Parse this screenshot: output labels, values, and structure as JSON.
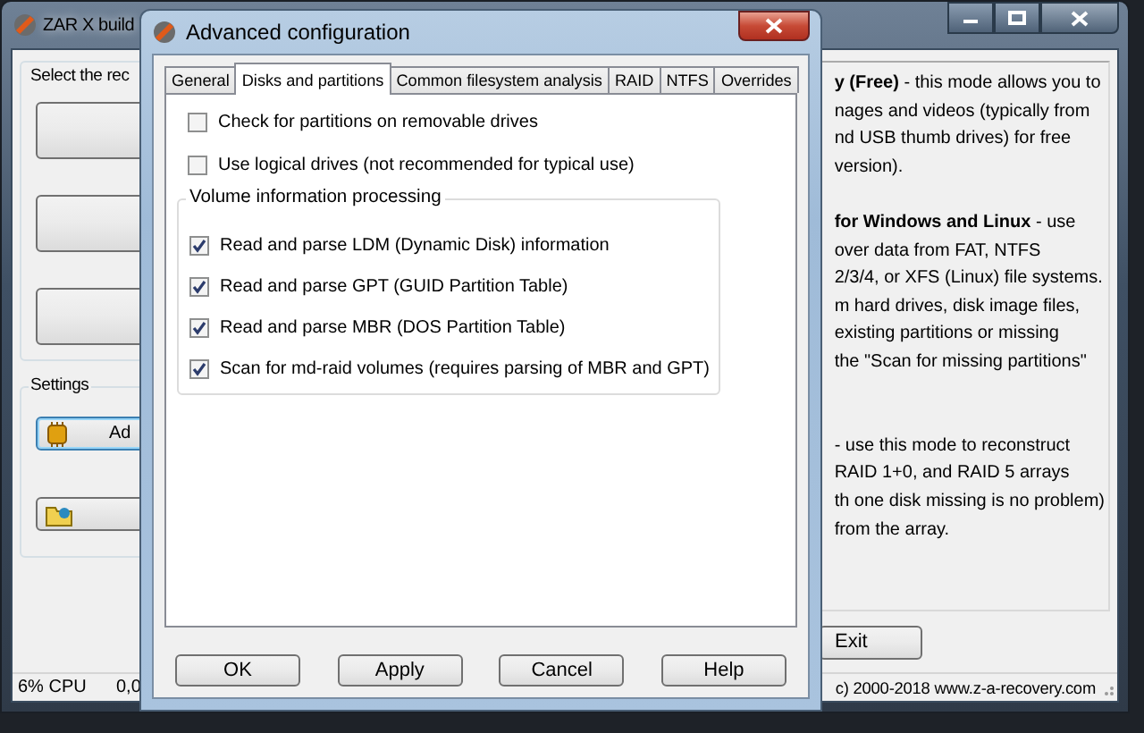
{
  "main_window": {
    "title": "ZAR X build",
    "select_group": {
      "title": "Select the rec"
    },
    "settings_group": {
      "title": "Settings",
      "buttons": [
        {
          "kind": "chip",
          "label": "Ad"
        },
        {
          "kind": "folder"
        }
      ]
    },
    "description": [
      {
        "text": "**y (Free)** - this mode allows you to"
      },
      {
        "text": "nages and videos (typically from"
      },
      {
        "text": "nd USB thumb drives) for free"
      },
      {
        "text": " version)."
      },
      {
        "kind": "gap"
      },
      {
        "text": "**for Windows and Linux** - use"
      },
      {
        "text": "over data from FAT, NTFS"
      },
      {
        "text": "2/3/4, or XFS (Linux) file systems."
      },
      {
        "text": "m hard drives, disk image files,"
      },
      {
        "text": "existing partitions or missing"
      },
      {
        "text": "the \"Scan for missing partitions\""
      },
      {
        "kind": "gap"
      },
      {
        "kind": "gap"
      },
      {
        "text": "- use this mode to reconstruct"
      },
      {
        "text": "RAID 1+0, and RAID 5 arrays"
      },
      {
        "text": "th one disk missing is no problem)"
      },
      {
        "text": "from the array."
      }
    ],
    "exit_button": "Exit",
    "status_bar": [
      "6% CPU",
      "0,0",
      "c) 2000-2018 www.z-a-recovery.com"
    ]
  },
  "dialog": {
    "title": "Advanced configuration",
    "tabs": [
      {
        "label": "General",
        "selected": false
      },
      {
        "label": "Disks and partitions",
        "selected": true
      },
      {
        "label": "Common filesystem analysis",
        "selected": false
      },
      {
        "label": "RAID",
        "selected": false
      },
      {
        "label": "NTFS",
        "selected": false
      },
      {
        "label": "Overrides",
        "selected": false
      }
    ],
    "options": [
      {
        "label": "Check for partitions on  removable drives",
        "checked": false
      },
      {
        "label": "Use logical drives (not recommended for typical use)",
        "checked": false
      }
    ],
    "volume_group": {
      "title": "Volume information processing",
      "options": [
        {
          "label": "Read and parse LDM (Dynamic Disk) information",
          "checked": true
        },
        {
          "label": "Read and parse GPT (GUID Partition Table)",
          "checked": true
        },
        {
          "label": "Read and parse MBR (DOS Partition Table)",
          "checked": true
        },
        {
          "label": "Scan for md-raid volumes (requires parsing of MBR and GPT)",
          "checked": true
        }
      ]
    },
    "buttons": [
      "OK",
      "Apply",
      "Cancel",
      "Help"
    ]
  }
}
